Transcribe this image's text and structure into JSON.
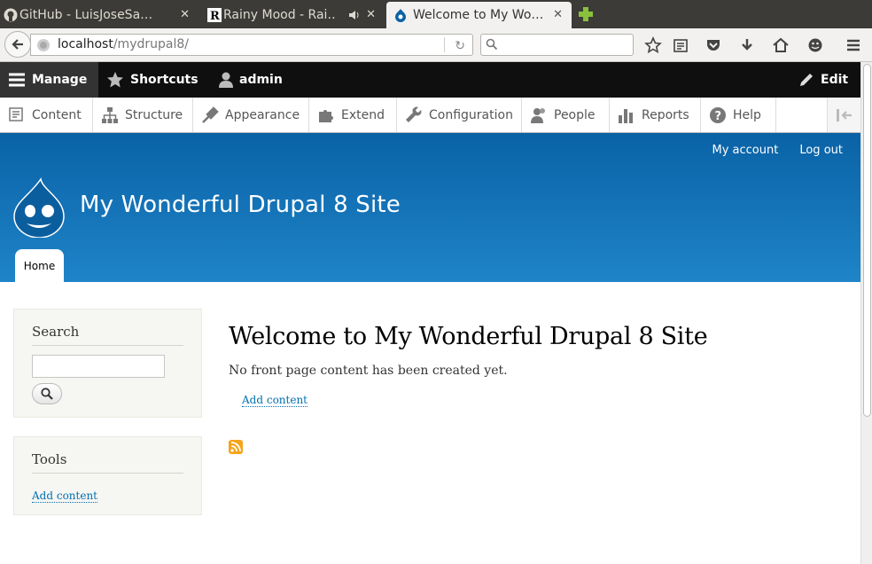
{
  "browser": {
    "tabs": [
      {
        "title": "GitHub - LuisJoseSa…",
        "active": false
      },
      {
        "title": "Rainy Mood - Rai…",
        "active": false
      },
      {
        "title": "Welcome to My Wo…",
        "active": true
      }
    ],
    "url_host": "localhost",
    "url_path": "/mydrupal8/",
    "search_placeholder": ""
  },
  "toolbar": {
    "manage": "Manage",
    "shortcuts": "Shortcuts",
    "user": "admin",
    "edit": "Edit"
  },
  "tray": {
    "items": [
      "Content",
      "Structure",
      "Appearance",
      "Extend",
      "Configuration",
      "People",
      "Reports",
      "Help"
    ]
  },
  "header": {
    "my_account": "My account",
    "log_out": "Log out",
    "site_name": "My Wonderful Drupal 8 Site",
    "home_tab": "Home"
  },
  "sidebar": {
    "search_title": "Search",
    "tools_title": "Tools",
    "tools_link": "Add content"
  },
  "main": {
    "title": "Welcome to My Wonderful Drupal 8 Site",
    "text": "No front page content has been created yet.",
    "link": "Add content"
  },
  "colors": {
    "header_top": "#0a62a6",
    "header_bottom": "#1f84c8",
    "link": "#0071b3",
    "admin_bar": "#0f0f0f"
  }
}
